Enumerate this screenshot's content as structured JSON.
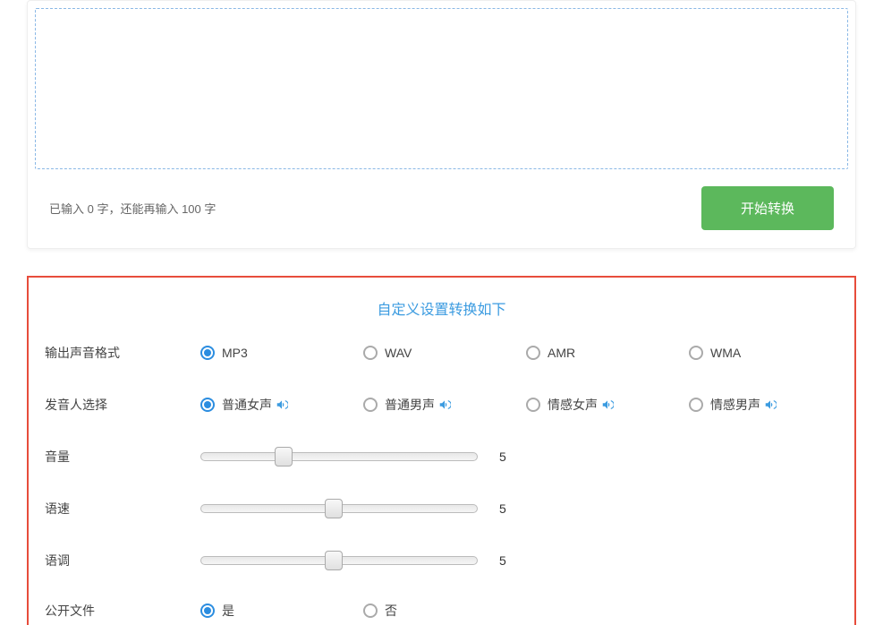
{
  "input": {
    "value": "",
    "placeholder": ""
  },
  "char_count": "已输入 0 字，还能再输入 100 字",
  "convert_button": "开始转换",
  "settings": {
    "title": "自定义设置转换如下",
    "output_format": {
      "label": "输出声音格式",
      "options": [
        "MP3",
        "WAV",
        "AMR",
        "WMA"
      ],
      "selected": "MP3"
    },
    "speaker": {
      "label": "发音人选择",
      "options": [
        "普通女声",
        "普通男声",
        "情感女声",
        "情感男声"
      ],
      "selected": "普通女声"
    },
    "volume": {
      "label": "音量",
      "value": "5"
    },
    "speed": {
      "label": "语速",
      "value": "5"
    },
    "pitch": {
      "label": "语调",
      "value": "5"
    },
    "public": {
      "label": "公开文件",
      "options": [
        "是",
        "否"
      ],
      "selected": "是"
    }
  }
}
